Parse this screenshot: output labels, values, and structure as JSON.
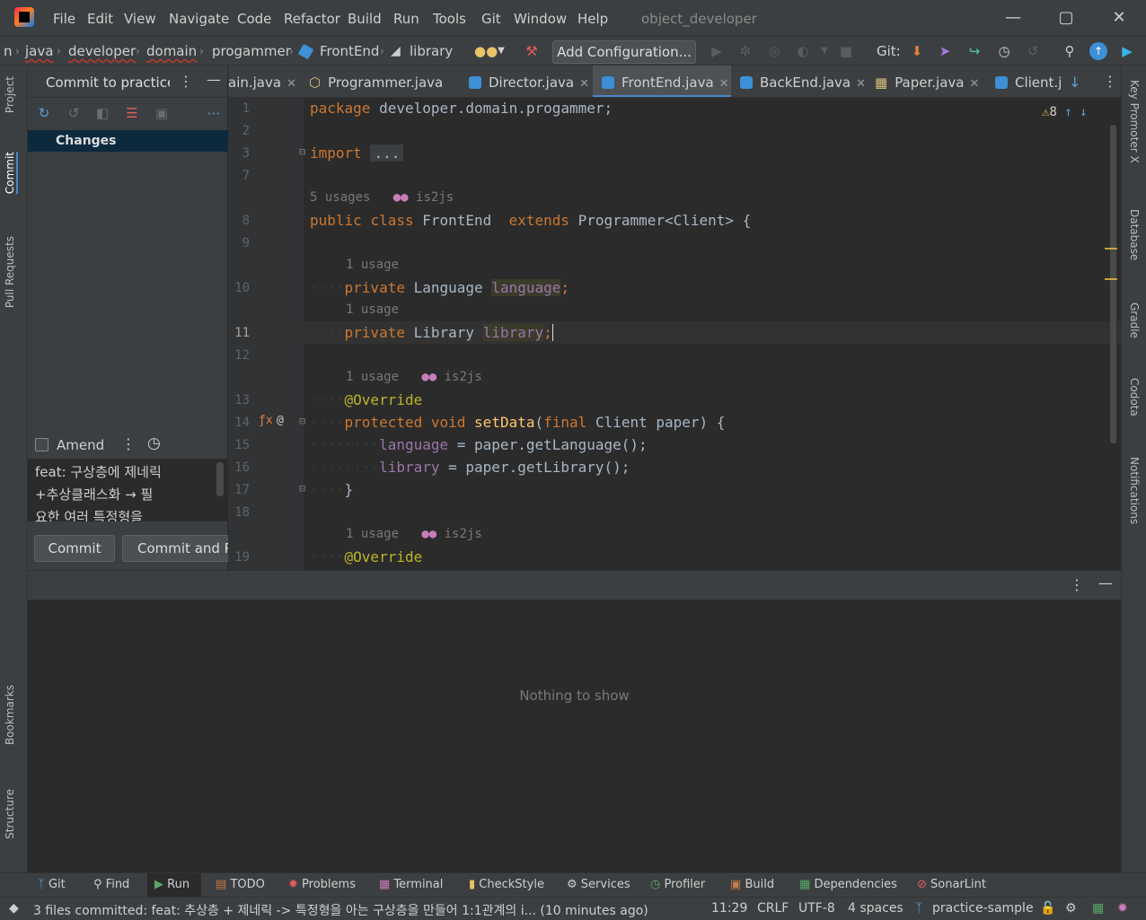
{
  "menubar": {
    "items": [
      "File",
      "Edit",
      "View",
      "Navigate",
      "Code",
      "Refactor",
      "Build",
      "Run",
      "Tools",
      "Git",
      "Window",
      "Help"
    ],
    "project_name": "object_developer"
  },
  "navbar": {
    "breadcrumbs": [
      "n",
      "java",
      "developer",
      "domain",
      "progammer",
      "FrontEnd",
      "library"
    ],
    "add_configuration": "Add Configuration...",
    "git_label": "Git:"
  },
  "left_strip": {
    "tabs": [
      "Project",
      "Commit",
      "Pull Requests",
      "Bookmarks",
      "Structure"
    ]
  },
  "right_strip": {
    "tabs": [
      "Key Promoter X",
      "Database",
      "Gradle",
      "Codota",
      "Notifications"
    ]
  },
  "commit_panel": {
    "title": "Commit to practice-sample",
    "changes_label": "Changes",
    "amend_label": "Amend",
    "message_lines": [
      "feat: 구상층에 제네릭",
      "+추상클래스화 → 필",
      "요한 여러 특정형을"
    ],
    "commit_button": "Commit",
    "commit_push_button": "Commit and Push..."
  },
  "tabs": [
    {
      "label": "ain.java",
      "active": false
    },
    {
      "label": "Programmer.java",
      "active": false
    },
    {
      "label": "Director.java",
      "active": false
    },
    {
      "label": "FrontEnd.java",
      "active": true
    },
    {
      "label": "BackEnd.java",
      "active": false
    },
    {
      "label": "Paper.java",
      "active": false
    },
    {
      "label": "Client.j",
      "active": false
    }
  ],
  "editor": {
    "warning_count": "8",
    "line_numbers": [
      "1",
      "2",
      "3",
      "7",
      "8",
      "9",
      "10",
      "11",
      "12",
      "13",
      "14",
      "15",
      "16",
      "17",
      "18",
      "19"
    ],
    "hints": {
      "class_usages": "5 usages",
      "author": "is2js",
      "one_usage": "1 usage"
    },
    "code": {
      "package_kw": "package",
      "package_name": "developer.domain.progammer;",
      "import_kw": "import",
      "import_fold": "...",
      "public_kw": "public",
      "class_kw": "class",
      "class_name": "FrontEnd",
      "extends_kw": "extends",
      "super_type": "Programmer<Client> {",
      "private_kw": "private",
      "type_language": "Language",
      "field_language": "language",
      "type_library": "Library",
      "field_library": "library",
      "override": "@Override",
      "protected_kw": "protected",
      "void_kw": "void",
      "method_name": "setData",
      "final_kw": "final",
      "param": "Client paper) {",
      "assign_language": "language",
      "assign_language_rhs": "= paper.getLanguage();",
      "assign_library": "library",
      "assign_library_rhs": "= paper.getLibrary();",
      "close_brace": "}",
      "semicolon": ";",
      "paren_open": "("
    }
  },
  "run_panel": {
    "empty_text": "Nothing to show"
  },
  "tool_windows": [
    "Git",
    "Find",
    "Run",
    "TODO",
    "Problems",
    "Terminal",
    "CheckStyle",
    "Services",
    "Profiler",
    "Build",
    "Dependencies",
    "SonarLint"
  ],
  "statusbar": {
    "message": "3 files committed: feat: 추상층 + 제네릭 -> 특정형을 아는 구상층을 만들어 1:1관계의 i... (10 minutes ago)",
    "position": "11:29",
    "line_sep": "CRLF",
    "encoding": "UTF-8",
    "indent": "4 spaces",
    "branch": "practice-sample"
  },
  "colors": {
    "background": "#2b2b2b",
    "panel": "#3c3f41",
    "accent": "#4a88c7",
    "keyword": "#cc7832",
    "field": "#9876aa",
    "method": "#ffc66d",
    "annotation": "#bbb529"
  }
}
